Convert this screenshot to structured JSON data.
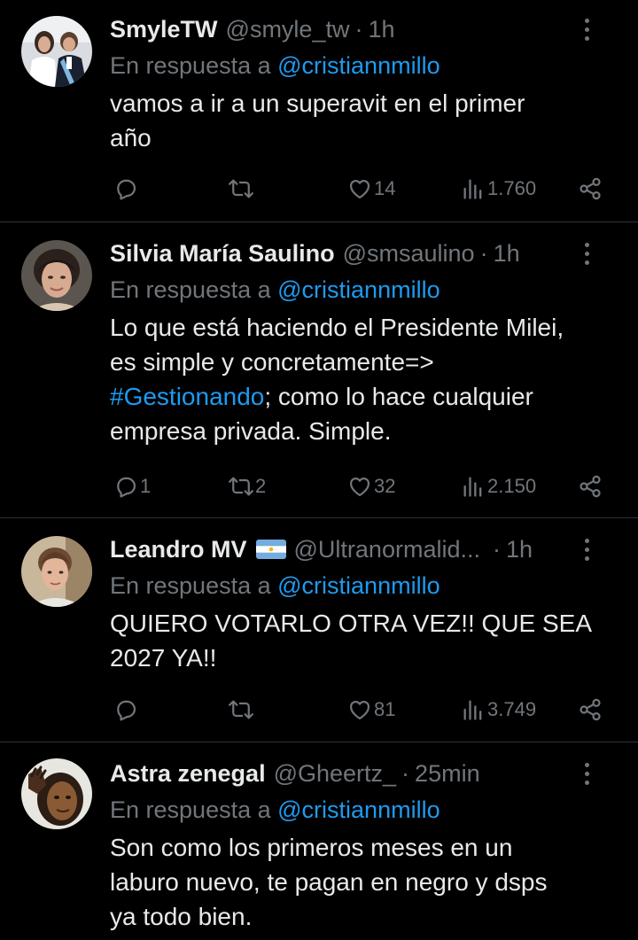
{
  "reply_prefix": "En respuesta a",
  "colors": {
    "background": "#000000",
    "text": "#e7e9ea",
    "muted": "#71767b",
    "accent": "#1d9bf0",
    "divider": "#2f3336"
  },
  "tweets": [
    {
      "name": "SmyleTW",
      "handle": "@smyle_tw",
      "time": "1h",
      "reply_to": "@cristiannmillo",
      "text": "vamos a ir a un superavit en el primer\naño",
      "hashtag": "",
      "text_after": "",
      "replies": "",
      "retweets": "",
      "likes": "14",
      "views": "1.760"
    },
    {
      "name": "Silvia María Saulino",
      "handle": "@smsaulino",
      "time": "1h",
      "reply_to": "@cristiannmillo",
      "text": "Lo que está haciendo el Presidente Milei,\nes simple y concretamente=>\n ",
      "hashtag": "#Gestionando",
      "text_after": "; como lo hace cualquier\nempresa privada. Simple.",
      "replies": "1",
      "retweets": "2",
      "likes": "32",
      "views": "2.150"
    },
    {
      "name": "Leandro MV",
      "handle": "@Ultranormalid...",
      "time": "1h",
      "reply_to": "@cristiannmillo",
      "text": "QUIERO VOTARLO OTRA VEZ!! QUE SEA\n2027 YA!!",
      "hashtag": "",
      "text_after": "",
      "replies": "",
      "retweets": "",
      "likes": "81",
      "views": "3.749"
    },
    {
      "name": "Astra zenegal",
      "handle": "@Gheertz_",
      "time": "25min",
      "reply_to": "@cristiannmillo",
      "text": "Son como los primeros meses en un\nlaburo nuevo, te pagan en negro y dsps\nya todo bien.",
      "hashtag": "",
      "text_after": ""
    }
  ],
  "icons": {
    "reply": "reply-icon",
    "retweet": "retweet-icon",
    "like": "heart-icon",
    "views": "views-icon",
    "share": "share-icon",
    "more": "more-options-icon",
    "flag": "argentina-flag-icon"
  }
}
